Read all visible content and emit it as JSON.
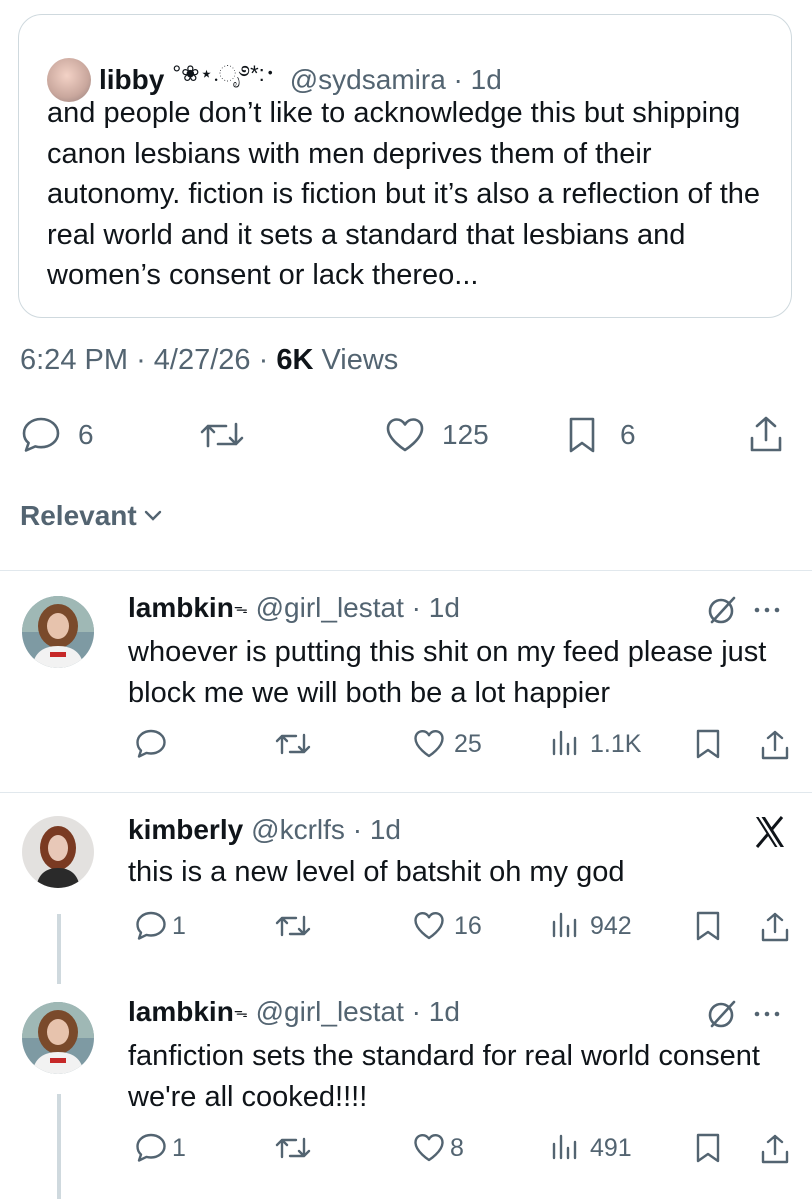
{
  "quote": {
    "name": "libby",
    "name_deco": "°❀⋆.ೃ࿔*:･",
    "handle": "@sydsamira",
    "age": "1d",
    "text": "and people don’t like to acknowledge this but shipping canon lesbians with men deprives them of their autonomy. fiction is fiction but it’s also a reflection of the real world and it sets a standard that lesbians and women’s consent or lack thereo..."
  },
  "meta": {
    "time": "6:24 PM",
    "date": "4/27/26",
    "views_count": "6K",
    "views_label": "Views"
  },
  "actions": {
    "replies": "6",
    "likes": "125",
    "bookmarks": "6"
  },
  "sort_label": "Relevant",
  "replies": [
    {
      "name": "lambkin",
      "name_deco": "ᯓ",
      "handle": "@girl_lestat",
      "age": "1d",
      "text": "whoever is putting this shit on my feed please just block me we will both be a lot happier",
      "likes": "25",
      "views": "1.1K"
    },
    {
      "name": "kimberly",
      "handle": "@kcrlfs",
      "age": "1d",
      "text": "this is a new level of batshit oh my god",
      "replies": "1",
      "likes": "16",
      "views": "942"
    },
    {
      "name": "lambkin",
      "name_deco": "ᯓ",
      "handle": "@girl_lestat",
      "age": "1d",
      "text": "fanfiction sets the standard for real world consent we're all cooked!!!!",
      "replies": "1",
      "likes": "8",
      "views": "491"
    }
  ],
  "icons": [
    "reply-icon",
    "repost-icon",
    "like-icon",
    "bookmark-icon",
    "share-icon",
    "views-icon",
    "grok-icon",
    "more-icon",
    "x-logo-icon",
    "chevron-down-icon"
  ]
}
